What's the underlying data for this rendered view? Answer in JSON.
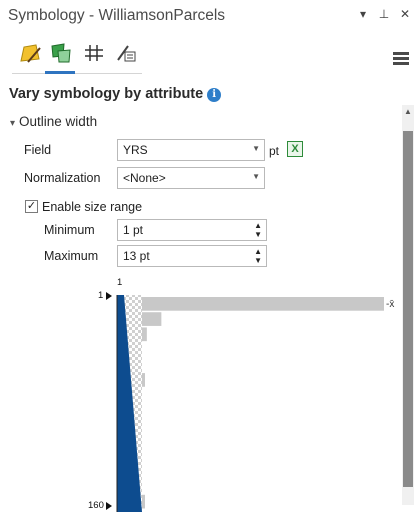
{
  "window": {
    "title": "Symbology - WilliamsonParcels",
    "controls": {
      "options": "▾",
      "pin": "⊥",
      "close": "✕"
    }
  },
  "tabs": [
    {
      "name": "primary-symbology",
      "icon": "paint-brush-polygon-icon",
      "active": false
    },
    {
      "name": "vary-symbology",
      "icon": "vary-symbology-icon",
      "active": true
    },
    {
      "name": "symbol-layers",
      "icon": "symbol-layers-icon",
      "active": false
    },
    {
      "name": "structure",
      "icon": "structure-icon",
      "active": false
    }
  ],
  "heading": {
    "text": "Vary symbology by attribute",
    "info": "i"
  },
  "section": {
    "chevron": "▾",
    "label": "Outline width"
  },
  "field": {
    "label": "Field",
    "value": "YRS",
    "unit": "pt",
    "expression_icon": "X"
  },
  "normalization": {
    "label": "Normalization",
    "value": "<None>"
  },
  "size_range": {
    "checkbox_label": "Enable size range",
    "checked": true,
    "check_glyph": "✓"
  },
  "minimum": {
    "label": "Minimum",
    "value": "1 pt"
  },
  "maximum": {
    "label": "Maximum",
    "value": "13 pt"
  },
  "histogram": {
    "top_axis_label": "1",
    "upper_break_label": "1",
    "lower_break_label": "160",
    "mean_marker": "-x̄",
    "bar_values": [
      100,
      8,
      2,
      0,
      0,
      1,
      0,
      0,
      0,
      0,
      0,
      0,
      0,
      1
    ]
  },
  "colors": {
    "accent": "#2f74c0",
    "ramp_fill": "#0d4c8f",
    "bar": "#c8c8c8",
    "scroll_thumb": "#8a8a8a"
  }
}
